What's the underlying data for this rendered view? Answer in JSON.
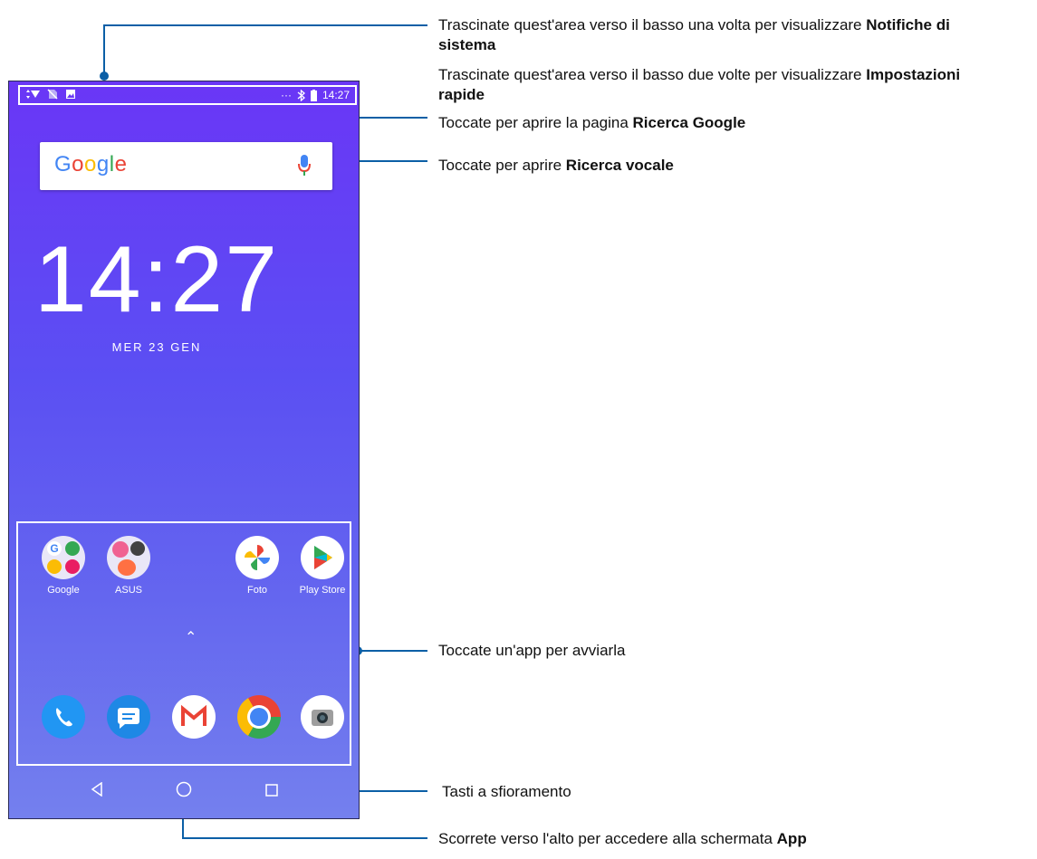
{
  "status_bar": {
    "time": "14:27"
  },
  "search": {
    "logo": "Google"
  },
  "clock": {
    "time": "14:27",
    "date": "MER 23 GEN"
  },
  "apps": [
    {
      "label": "Google"
    },
    {
      "label": "ASUS"
    },
    {
      "label": "Foto"
    },
    {
      "label": "Play Store"
    }
  ],
  "dock": [
    {
      "icon": "phone-icon"
    },
    {
      "icon": "messages-icon"
    },
    {
      "icon": "gmail-icon"
    },
    {
      "icon": "chrome-icon"
    },
    {
      "icon": "camera-icon"
    }
  ],
  "annotations": {
    "notif_pre": "Trascinate quest'area verso il basso una volta per visualizzare ",
    "notif_bold_a": "Notifiche di",
    "notif_bold_b": "sistema",
    "quick_pre": "Trascinate quest'area verso il basso due volte per visualizzare ",
    "quick_bold_a": "Impostazioni",
    "quick_bold_b": "rapide",
    "google_pre": "Toccate per aprire la pagina ",
    "google_bold": "Ricerca Google",
    "voice_pre": "Toccate per aprire ",
    "voice_bold": "Ricerca vocale",
    "app_text": "Toccate un'app per avviarla",
    "keys_text": "Tasti a sfioramento",
    "swipe_pre": "Scorrete verso l'alto per accedere alla schermata ",
    "swipe_bold": "App"
  },
  "colors": {
    "accent_line": "#0b5fa6",
    "wallpaper_top": "#6a36f6",
    "wallpaper_bottom": "#7480ee"
  }
}
